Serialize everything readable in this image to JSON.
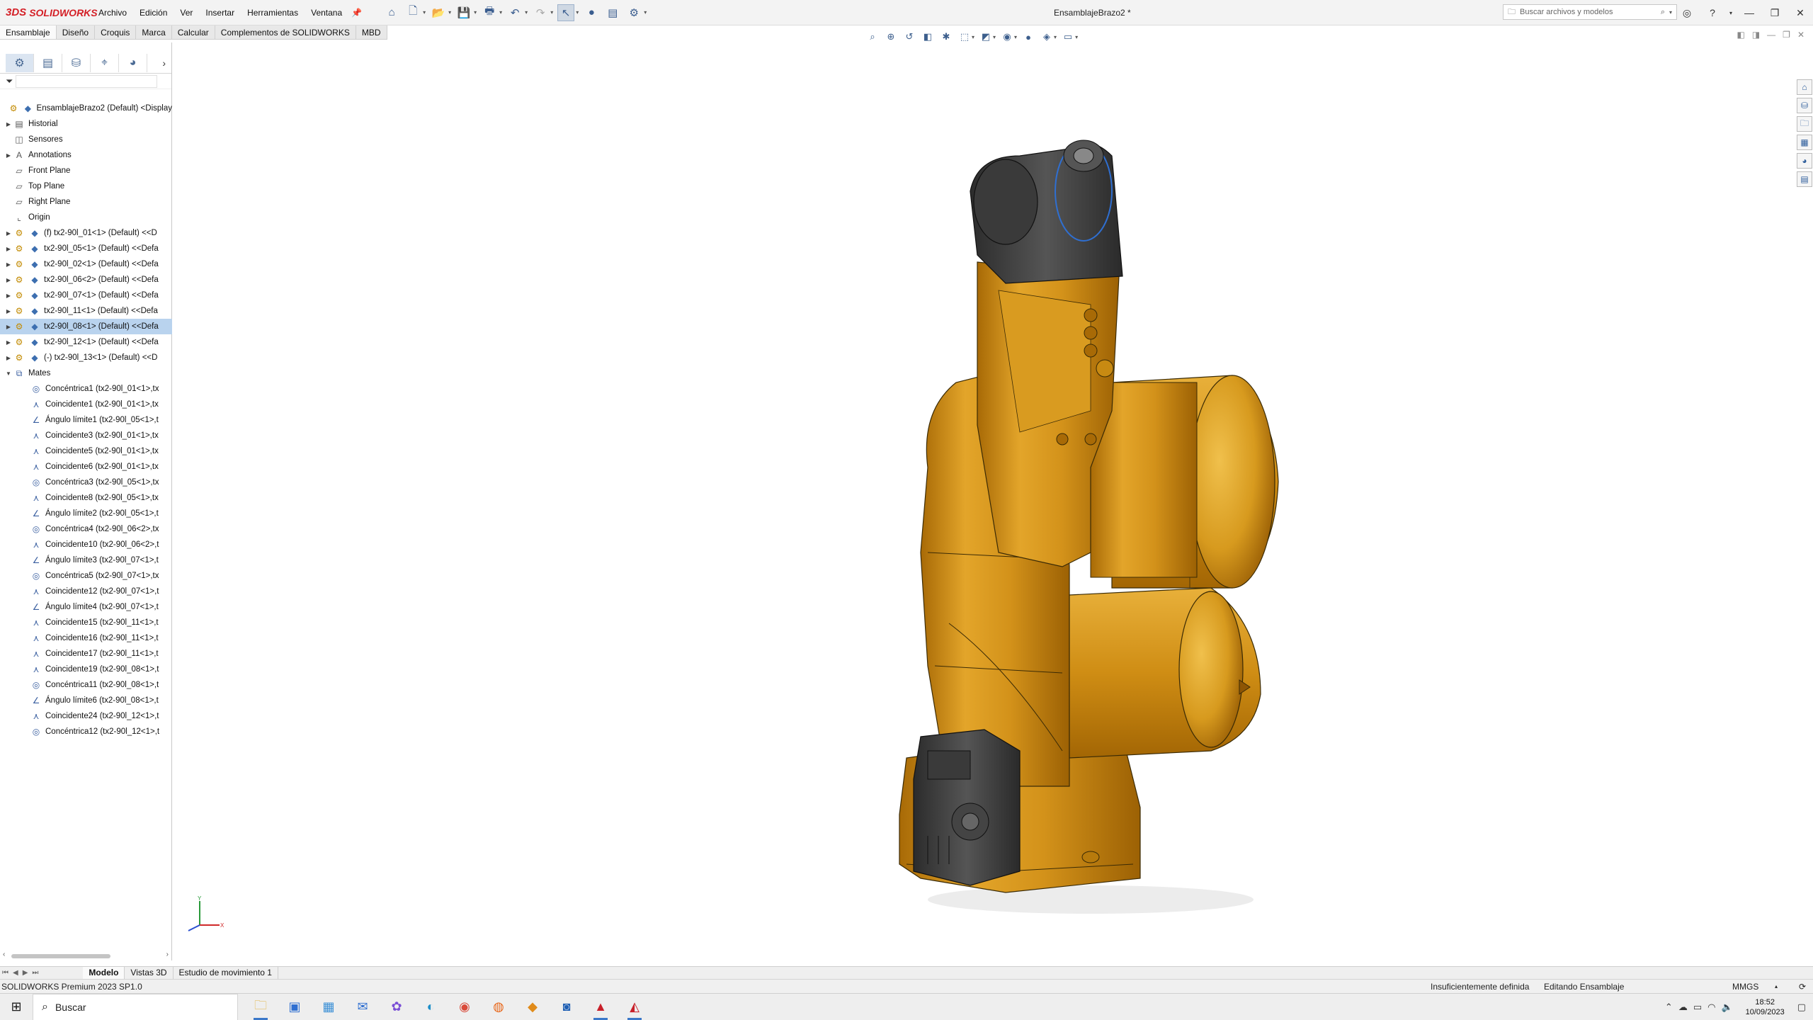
{
  "app": {
    "brand_mark": "3DS",
    "brand_name": "SOLIDWORKS",
    "document_title": "EnsamblajeBrazo2 *"
  },
  "menu": [
    "Archivo",
    "Edición",
    "Ver",
    "Insertar",
    "Herramientas",
    "Ventana"
  ],
  "search": {
    "placeholder": "Buscar archivos y modelos"
  },
  "command_tabs": [
    "Ensamblaje",
    "Diseño",
    "Croquis",
    "Marca",
    "Calcular",
    "Complementos de SOLIDWORKS",
    "MBD"
  ],
  "tree": {
    "root": "EnsamblajeBrazo2 (Default) <Display",
    "features": [
      {
        "label": "Historial",
        "icon": "folder-icon",
        "expand": "▶"
      },
      {
        "label": "Sensores",
        "icon": "sensor-icon",
        "expand": ""
      },
      {
        "label": "Annotations",
        "icon": "annotation-icon",
        "expand": "▶"
      },
      {
        "label": "Front Plane",
        "icon": "plane-icon",
        "expand": ""
      },
      {
        "label": "Top Plane",
        "icon": "plane-icon",
        "expand": ""
      },
      {
        "label": "Right Plane",
        "icon": "plane-icon",
        "expand": ""
      },
      {
        "label": "Origin",
        "icon": "origin-icon",
        "expand": ""
      }
    ],
    "components": [
      {
        "label": "(f) tx2-90l_01<1> (Default) <<D",
        "selected": false
      },
      {
        "label": "tx2-90l_05<1> (Default) <<Defa",
        "selected": false
      },
      {
        "label": "tx2-90l_02<1> (Default) <<Defa",
        "selected": false
      },
      {
        "label": "tx2-90l_06<2> (Default) <<Defa",
        "selected": false
      },
      {
        "label": "tx2-90l_07<1> (Default) <<Defa",
        "selected": false
      },
      {
        "label": "tx2-90l_11<1> (Default) <<Defa",
        "selected": false
      },
      {
        "label": "tx2-90l_08<1> (Default) <<Defa",
        "selected": true
      },
      {
        "label": "tx2-90l_12<1> (Default) <<Defa",
        "selected": false
      },
      {
        "label": "(-) tx2-90l_13<1> (Default) <<D",
        "selected": false
      }
    ],
    "mates_label": "Mates",
    "mates": [
      {
        "label": "Concéntrica1 (tx2-90l_01<1>,tx",
        "type": "concentric"
      },
      {
        "label": "Coincidente1 (tx2-90l_01<1>,tx",
        "type": "coincident"
      },
      {
        "label": "Ángulo límite1 (tx2-90l_05<1>,t",
        "type": "angle"
      },
      {
        "label": "Coincidente3 (tx2-90l_01<1>,tx",
        "type": "coincident"
      },
      {
        "label": "Coincidente5 (tx2-90l_01<1>,tx",
        "type": "coincident"
      },
      {
        "label": "Coincidente6 (tx2-90l_01<1>,tx",
        "type": "coincident"
      },
      {
        "label": "Concéntrica3 (tx2-90l_05<1>,tx",
        "type": "concentric"
      },
      {
        "label": "Coincidente8 (tx2-90l_05<1>,tx",
        "type": "coincident"
      },
      {
        "label": "Ángulo límite2 (tx2-90l_05<1>,t",
        "type": "angle"
      },
      {
        "label": "Concéntrica4 (tx2-90l_06<2>,tx",
        "type": "concentric"
      },
      {
        "label": "Coincidente10 (tx2-90l_06<2>,t",
        "type": "coincident"
      },
      {
        "label": "Ángulo límite3 (tx2-90l_07<1>,t",
        "type": "angle"
      },
      {
        "label": "Concéntrica5 (tx2-90l_07<1>,tx",
        "type": "concentric"
      },
      {
        "label": "Coincidente12 (tx2-90l_07<1>,t",
        "type": "coincident"
      },
      {
        "label": "Ángulo límite4 (tx2-90l_07<1>,t",
        "type": "angle"
      },
      {
        "label": "Coincidente15 (tx2-90l_11<1>,t",
        "type": "coincident"
      },
      {
        "label": "Coincidente16 (tx2-90l_11<1>,t",
        "type": "coincident"
      },
      {
        "label": "Coincidente17 (tx2-90l_11<1>,t",
        "type": "coincident"
      },
      {
        "label": "Coincidente19 (tx2-90l_08<1>,t",
        "type": "coincident"
      },
      {
        "label": "Concéntrica11 (tx2-90l_08<1>,t",
        "type": "concentric"
      },
      {
        "label": "Ángulo límite6 (tx2-90l_08<1>,t",
        "type": "angle"
      },
      {
        "label": "Coincidente24 (tx2-90l_12<1>,t",
        "type": "coincident"
      },
      {
        "label": "Concéntrica12 (tx2-90l_12<1>,t",
        "type": "concentric"
      }
    ]
  },
  "bottom_tabs": [
    "Modelo",
    "Vistas 3D",
    "Estudio de movimiento 1"
  ],
  "status": {
    "product": "SOLIDWORKS Premium 2023 SP1.0",
    "definition": "Insuficientemente definida",
    "mode": "Editando Ensamblaje",
    "units": "MMGS"
  },
  "taskbar": {
    "search_placeholder": "Buscar",
    "time": "18:52",
    "date": "10/09/2023"
  },
  "colors": {
    "model_gold": "#d9961a",
    "selection": "#b9d3ee",
    "brand_red": "#d41f26"
  }
}
